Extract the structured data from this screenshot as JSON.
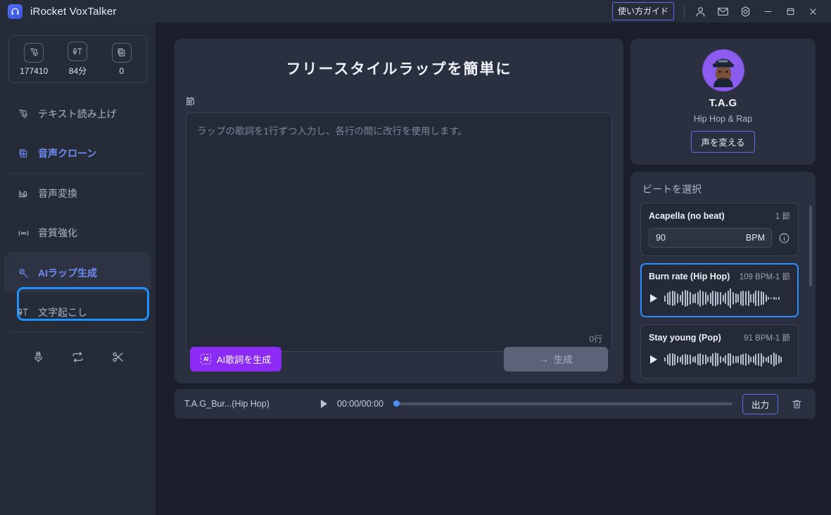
{
  "titlebar": {
    "app_title": "iRocket VoxTalker",
    "logo_icon": "headphones-logo-icon",
    "guide_button": "使い方ガイド",
    "icons": [
      {
        "name": "account-icon",
        "label": "アカウント"
      },
      {
        "name": "mail-icon",
        "label": "メール"
      },
      {
        "name": "settings-icon",
        "label": "設定"
      },
      {
        "name": "minimize-icon",
        "label": "最小化"
      },
      {
        "name": "maximize-icon",
        "label": "最大化"
      },
      {
        "name": "close-icon",
        "label": "閉じる"
      }
    ]
  },
  "sidebar": {
    "stats": [
      {
        "icon": "tts-character-icon",
        "value": "177410"
      },
      {
        "icon": "transcribe-minutes-icon",
        "value": "84分"
      },
      {
        "icon": "voice-clone-count-icon",
        "value": "0"
      }
    ],
    "items": [
      {
        "label": "テキスト読み上げ",
        "icon": "text-to-speech-icon",
        "active": false
      },
      {
        "label": "音声クローン",
        "icon": "voice-clone-icon",
        "active": true
      },
      {
        "label": "音声変換",
        "icon": "voice-change-icon",
        "active": false
      },
      {
        "label": "音質強化",
        "icon": "audio-enhance-icon",
        "active": false
      },
      {
        "label": "AIラップ生成",
        "icon": "ai-rap-icon",
        "active": false,
        "highlighted": true
      },
      {
        "label": "文字起こし",
        "icon": "transcribe-icon",
        "active": false
      }
    ],
    "tools": [
      {
        "name": "microphone-icon"
      },
      {
        "name": "loop-icon"
      },
      {
        "name": "scissors-icon"
      }
    ]
  },
  "main": {
    "title": "フリースタイルラップを簡単に",
    "field_label": "節",
    "textarea_placeholder": "ラップの歌詞を1行ずつ入力し、各行の間に改行を使用します。",
    "textarea_value": "",
    "line_count": "0行",
    "ai_lyrics_button": "AI歌詞を生成",
    "ai_chip_label": "AI",
    "generate_button": "生成",
    "generate_arrow": "→"
  },
  "voice_card": {
    "avatar_icon": "rapper-avatar",
    "name": "T.A.G",
    "genre": "Hip Hop & Rap",
    "change_voice_button": "声を変える"
  },
  "beats": {
    "title": "ビートを選択",
    "items": [
      {
        "name": "Acapella (no beat)",
        "meta": "1 節",
        "type": "bpm-input",
        "bpm_value": "90",
        "bpm_unit": "BPM",
        "info_icon": "info-icon",
        "selected": false
      },
      {
        "name": "Burn rate (Hip Hop)",
        "meta": "109 BPM-1 節",
        "type": "waveform",
        "play_icon": "play-icon",
        "selected": true
      },
      {
        "name": "Stay young (Pop)",
        "meta": "91 BPM-1 節",
        "type": "waveform",
        "play_icon": "play-icon",
        "selected": false
      }
    ]
  },
  "player": {
    "track_name": "T.A.G_Bur...(Hip Hop)",
    "play_icon": "play-icon",
    "time": "00:00/00:00",
    "progress_percent": 0,
    "export_button": "出力",
    "delete_icon": "trash-icon"
  },
  "colors": {
    "window_bg": "#1b1f2b",
    "panel_bg": "#2a3040",
    "sidebar_bg": "#262b38",
    "accent_purple": "#8b2bf5",
    "accent_blue": "#5b6fe8",
    "highlight_ring": "#1e90ff",
    "selected_beat": "#2b8cff"
  }
}
